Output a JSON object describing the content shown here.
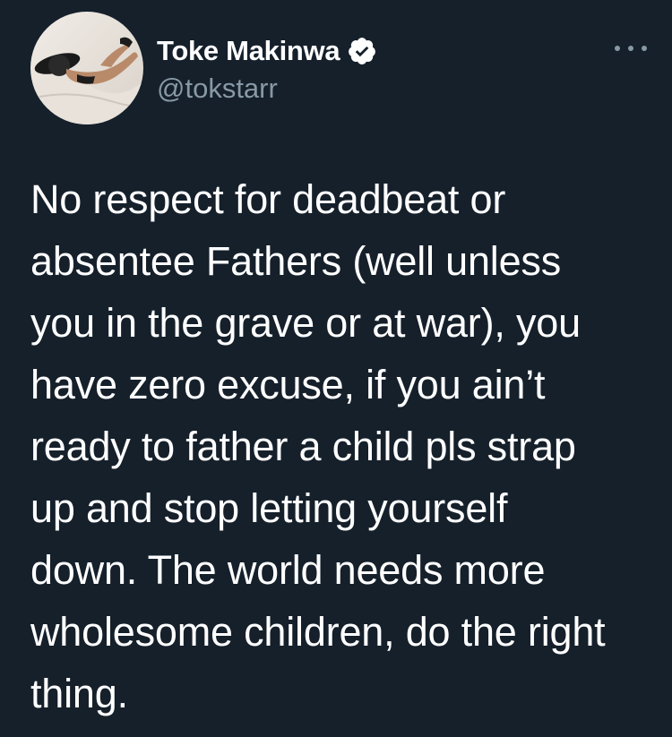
{
  "author": {
    "display_name": "Toke Makinwa",
    "handle": "@tokstarr",
    "verified": true
  },
  "tweet": {
    "text": "No respect for deadbeat or\nabsentee Fathers (well unless\nyou in the grave or at war), you\nhave zero excuse, if you ain’t\nready to father a child pls strap\nup and stop letting yourself\ndown. The world needs more\nwholesome children, do the right\nthing."
  },
  "icons": {
    "verified": "verified-badge-icon",
    "more": "more-options-icon"
  },
  "colors": {
    "background": "#15202b",
    "text_primary": "#ffffff",
    "text_secondary": "#8899a6"
  }
}
